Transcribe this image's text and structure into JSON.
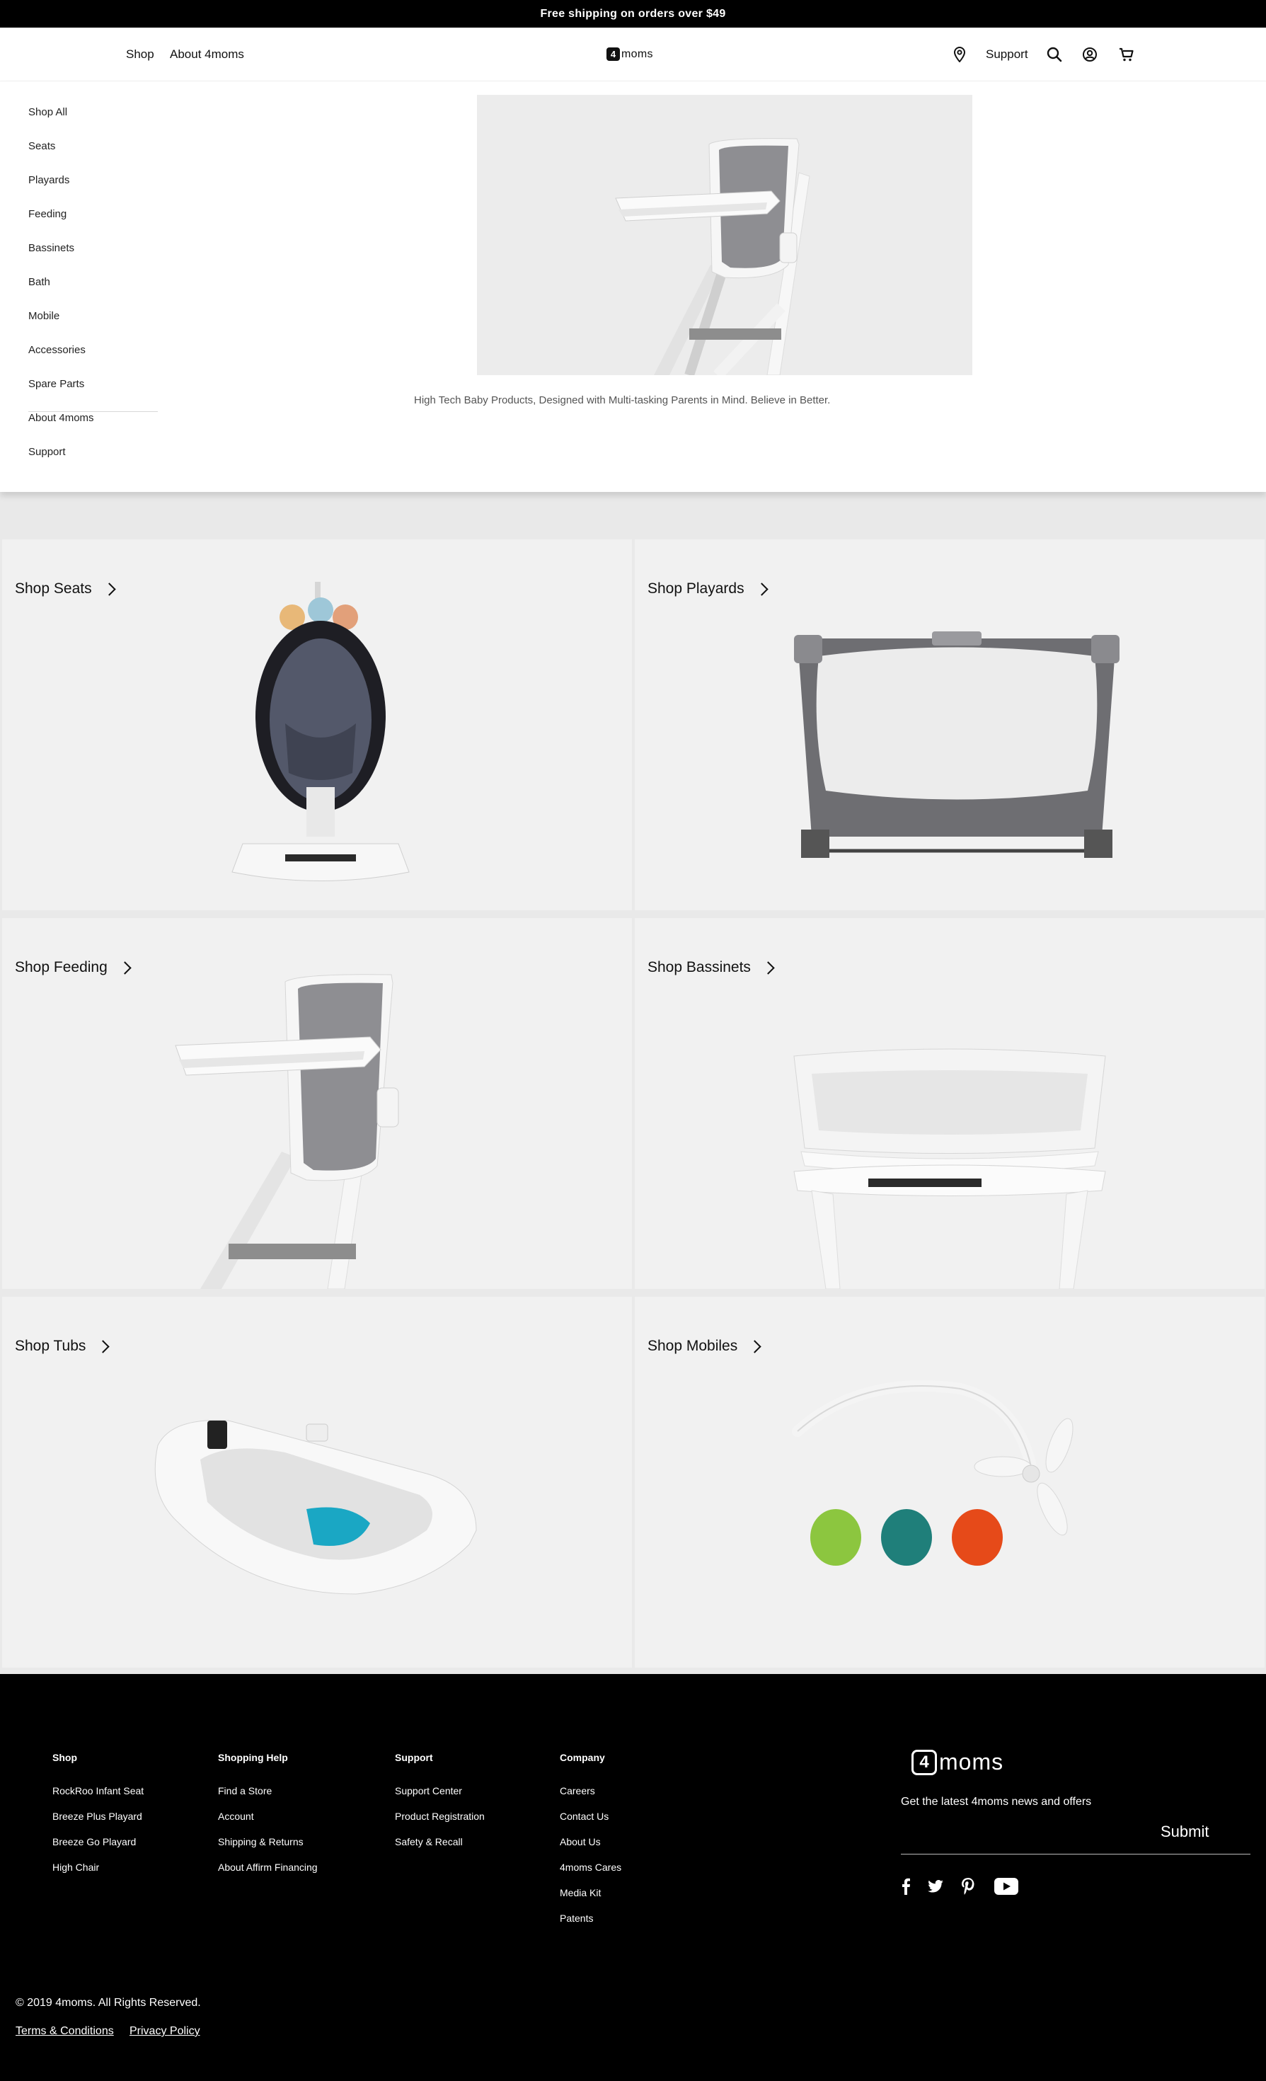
{
  "announcement": "Free shipping on orders over $49",
  "header": {
    "nav": [
      "Shop",
      "About 4moms"
    ],
    "logo_mark": "4",
    "logo_text": "moms",
    "support_label": "Support"
  },
  "mega_menu": {
    "items": [
      "Shop All",
      "Seats",
      "Playards",
      "Feeding",
      "Bassinets",
      "Bath",
      "Mobile",
      "Accessories",
      "Spare Parts",
      "About 4moms",
      "Support"
    ],
    "tagline": "High Tech Baby Products, Designed with Multi-tasking Parents in Mind. Believe in Better."
  },
  "tiles": [
    {
      "label": "Shop Seats"
    },
    {
      "label": "Shop Playards"
    },
    {
      "label": "Shop Feeding"
    },
    {
      "label": "Shop Bassinets"
    },
    {
      "label": "Shop Tubs"
    },
    {
      "label": "Shop Mobiles"
    }
  ],
  "footer": {
    "columns": [
      {
        "title": "Shop",
        "links": [
          "RockRoo Infant Seat",
          "Breeze Plus Playard",
          "Breeze Go Playard",
          "High Chair"
        ]
      },
      {
        "title": "Shopping Help",
        "links": [
          "Find a Store",
          "Account",
          "Shipping & Returns",
          "About Affirm Financing"
        ]
      },
      {
        "title": "Support",
        "links": [
          "Support Center",
          "Product Registration",
          "Safety & Recall"
        ]
      },
      {
        "title": "Company",
        "links": [
          "Careers",
          "Contact Us",
          "About Us",
          "4moms Cares",
          "Media Kit",
          "Patents"
        ]
      }
    ],
    "logo_mark": "4",
    "logo_text": "moms",
    "newsletter_text": "Get the latest 4moms news and offers",
    "submit_label": "Submit",
    "social_icons": [
      "facebook-icon",
      "twitter-icon",
      "pinterest-icon",
      "youtube-icon"
    ],
    "copyright": "© 2019 4moms. All Rights Reserved.",
    "legal_links": [
      "Terms & Conditions",
      "Privacy Policy"
    ]
  }
}
